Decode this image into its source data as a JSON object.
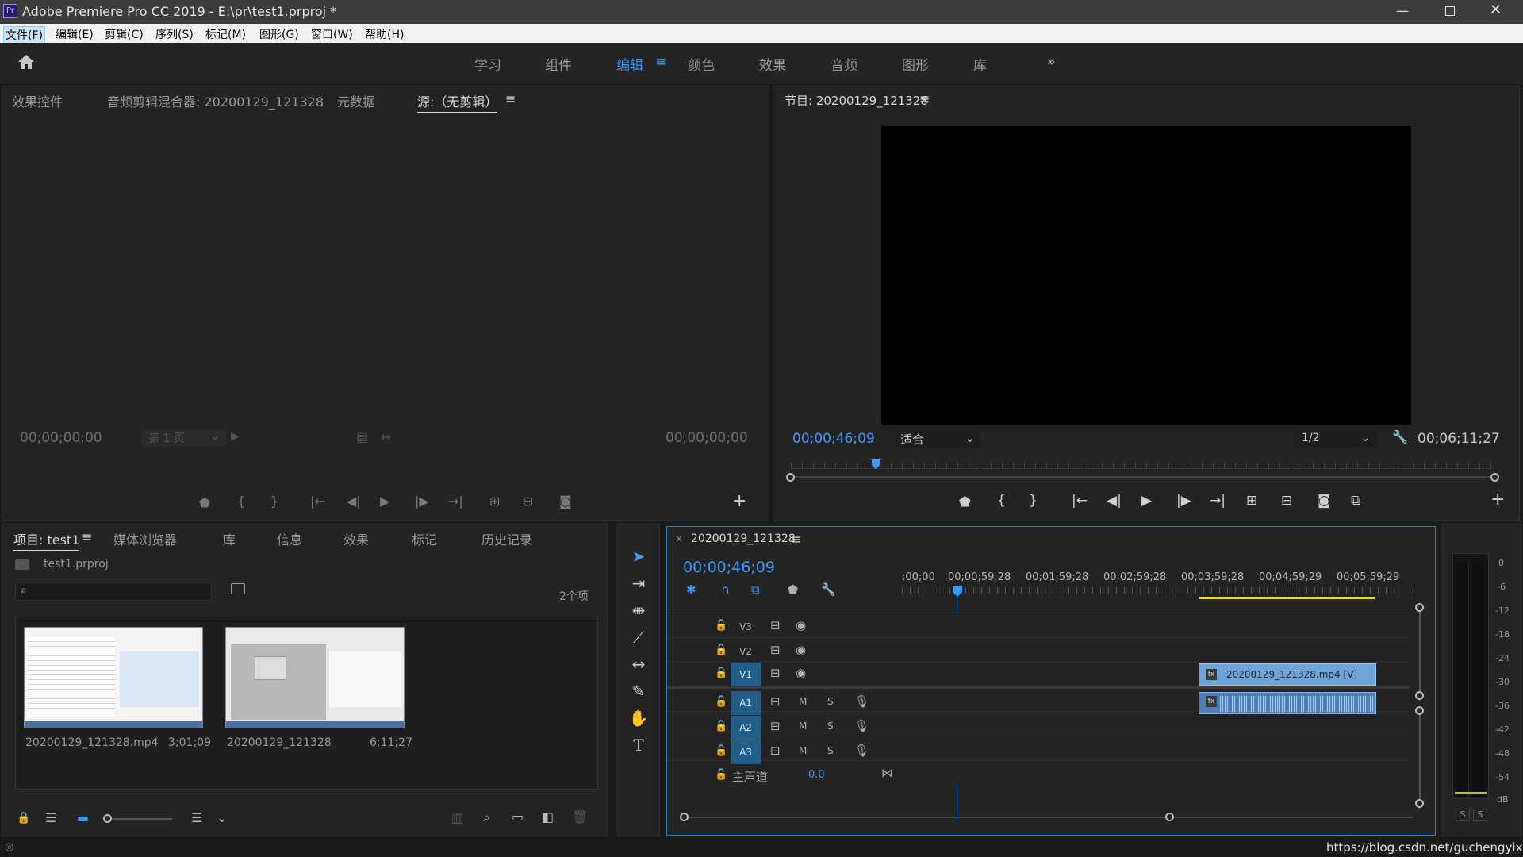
{
  "app": {
    "title": "Adobe Premiere Pro CC 2019 - E:\\pr\\test1.prproj *",
    "icon_label": "Pr"
  },
  "menu": [
    "文件(F)",
    "编辑(E)",
    "剪辑(C)",
    "序列(S)",
    "标记(M)",
    "图形(G)",
    "窗口(W)",
    "帮助(H)"
  ],
  "workspaces": [
    "学习",
    "组件",
    "编辑",
    "颜色",
    "效果",
    "音频",
    "图形",
    "库"
  ],
  "source_panel": {
    "tabs": [
      "效果控件",
      "音频剪辑混合器: 20200129_121328",
      "元数据",
      "源:（无剪辑）"
    ],
    "tc_left": "00;00;00;00",
    "page_label": "第 1 页",
    "tc_right": "00;00;00;00"
  },
  "program_panel": {
    "title": "节目: 20200129_121328",
    "tc_current": "00;00;46;09",
    "fit": "适合",
    "res": "1/2",
    "tc_duration": "00;06;11;27"
  },
  "project_panel": {
    "tabs": [
      "项目: test1",
      "媒体浏览器",
      "库",
      "信息",
      "效果",
      "标记",
      "历史记录"
    ],
    "file": "test1.prproj",
    "count": "2个项",
    "items": [
      {
        "name": "20200129_121328.mp4",
        "duration": "3;01;09"
      },
      {
        "name": "20200129_121328",
        "duration": "6;11;27"
      }
    ]
  },
  "timeline": {
    "seq_name": "20200129_121328",
    "tc": "00;00;46;09",
    "ruler": [
      ";00;00",
      "00;00;59;28",
      "00;01;59;28",
      "00;02;59;28",
      "00;03;59;28",
      "00;04;59;29",
      "00;05;59;29"
    ],
    "tracks": [
      "V3",
      "V2",
      "V1",
      "A1",
      "A2",
      "A3"
    ],
    "master_label": "主声道",
    "master_value": "0.0",
    "clip_label": "20200129_121328.mp4 [V]"
  },
  "meter": {
    "scale": [
      "0",
      "-6",
      "-12",
      "-18",
      "-24",
      "-30",
      "-36",
      "-42",
      "-48",
      "-54",
      "dB"
    ],
    "solo": [
      "S",
      "S"
    ]
  },
  "footer": {
    "watermark": "https://blog.csdn.net/guchengyixin"
  },
  "colors": {
    "accent": "#3d9bff",
    "yellow": "#e5d62a",
    "clip": "#6fa4d8"
  }
}
